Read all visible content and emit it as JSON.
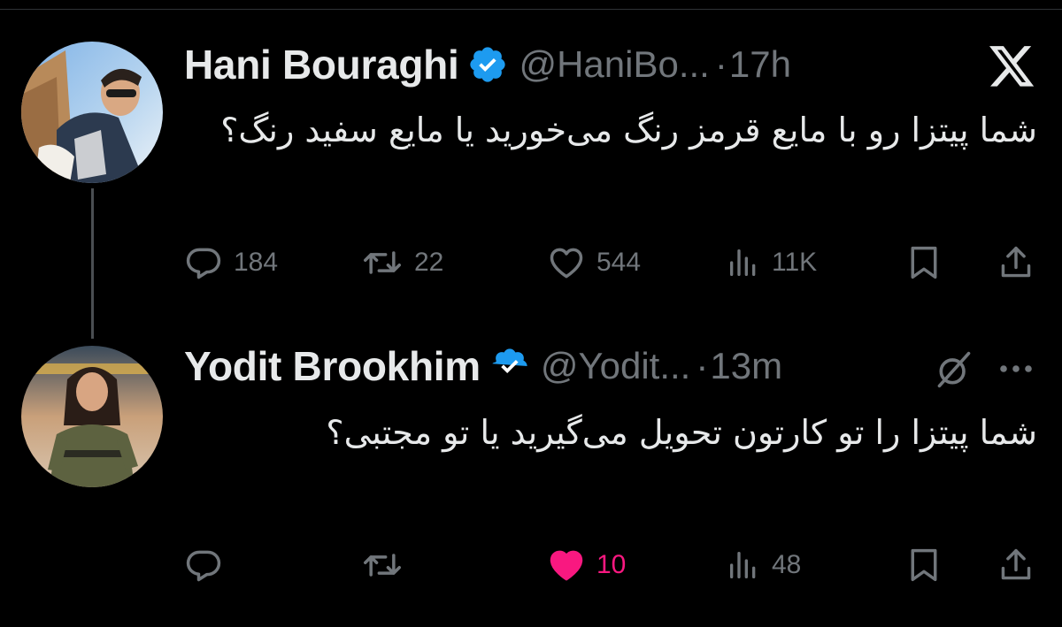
{
  "colors": {
    "background": "#000000",
    "text": "#e7e9ea",
    "muted": "#71767b",
    "verified": "#1d9bf0",
    "like_active": "#f91880"
  },
  "icons": {
    "brand": "x-logo-icon",
    "verified": "verified-badge-icon",
    "reply": "reply-icon",
    "repost": "repost-icon",
    "like": "heart-icon",
    "views": "views-icon",
    "bookmark": "bookmark-icon",
    "share": "share-icon",
    "grok": "grok-icon",
    "more": "more-icon"
  },
  "tweets": [
    {
      "name": "Hani Bouraghi",
      "handle": "@HaniBo...",
      "separator": "·",
      "time": "17h",
      "text": "شما پیتزا رو با مایع قرمز رنگ می‌خورید یا مایع سفید رنگ؟",
      "replies": "184",
      "reposts": "22",
      "likes": "544",
      "liked": false,
      "views": "11K"
    },
    {
      "name": "Yodit Brookhim",
      "handle": "@Yodit...",
      "separator": "·",
      "time": "13m",
      "text": "شما پیتزا را تو کارتون تحویل می‌گیرید یا تو مجتبی؟",
      "replies": "",
      "reposts": "",
      "likes": "10",
      "liked": true,
      "views": "48"
    }
  ]
}
